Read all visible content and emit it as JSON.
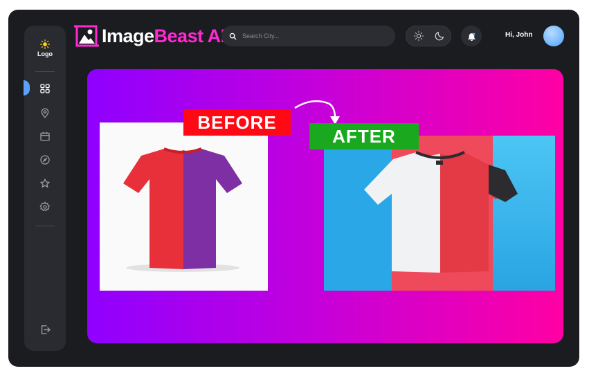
{
  "sidebar": {
    "logo_label": "Logo",
    "nav": [
      {
        "icon": "grid-icon",
        "active": true
      },
      {
        "icon": "map-pin-icon",
        "active": false
      },
      {
        "icon": "calendar-icon",
        "active": false
      },
      {
        "icon": "compass-icon",
        "active": false
      },
      {
        "icon": "star-icon",
        "active": false
      },
      {
        "icon": "gear-icon",
        "active": false
      }
    ],
    "logout_icon": "logout-icon"
  },
  "header": {
    "brand_part1": "Image",
    "brand_part2": "Beast AI",
    "search_placeholder": "Search City...",
    "theme_options": [
      "light",
      "dark"
    ],
    "greeting": "Hi, John"
  },
  "banner": {
    "before_label": "BEFORE",
    "after_label": "AFTER"
  },
  "colors": {
    "frame": "#1b1c20",
    "panel": "#2a2b30",
    "brand_accent": "#ff2ad3",
    "banner_start": "#8f00ff",
    "banner_end": "#ff00a3",
    "before_badge": "#ff0a14",
    "after_badge": "#1aa91e",
    "active_marker": "#5aa2ff"
  }
}
